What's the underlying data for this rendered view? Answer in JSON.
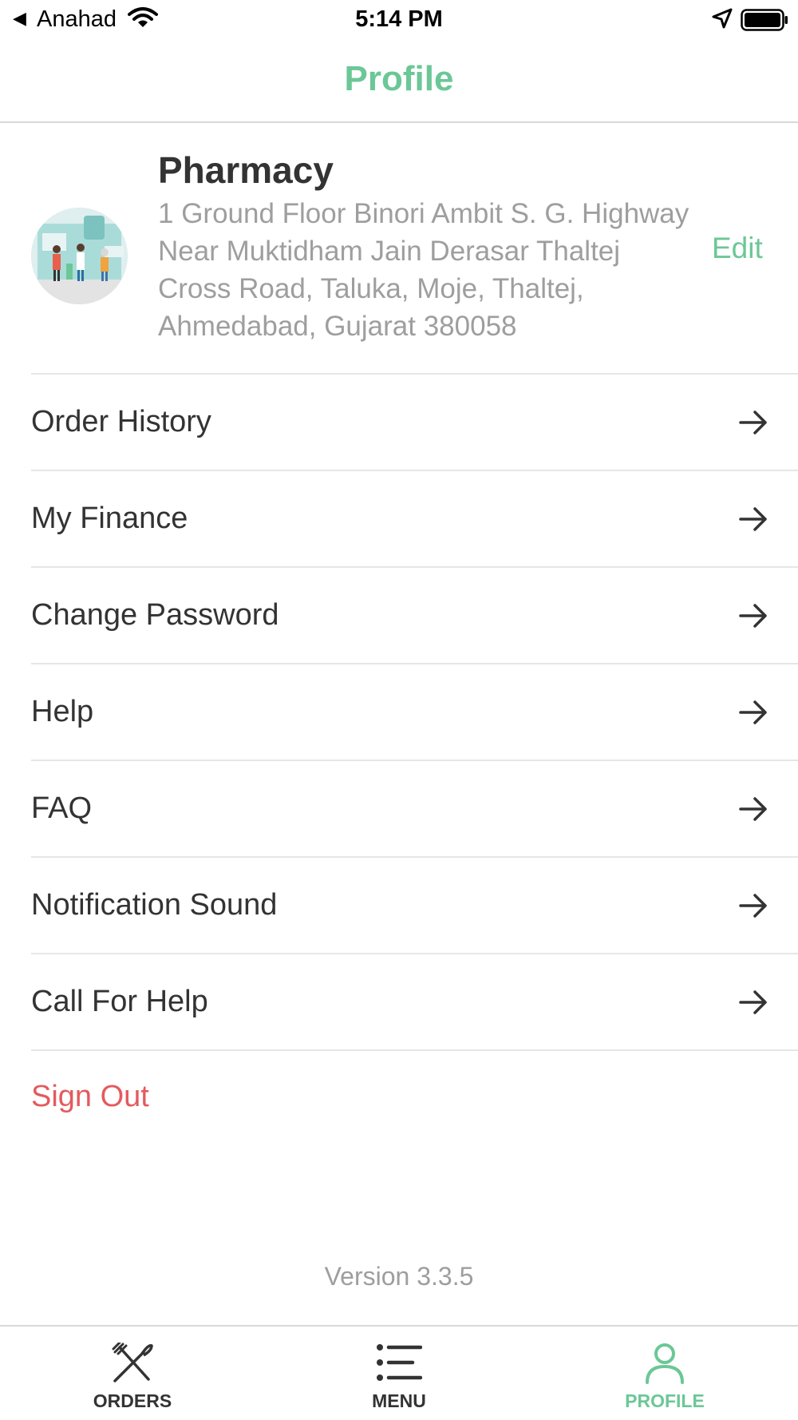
{
  "status_bar": {
    "back_label": "Anahad",
    "time": "5:14 PM"
  },
  "nav": {
    "title": "Profile"
  },
  "profile": {
    "name": "Pharmacy",
    "address": "1 Ground Floor Binori Ambit S. G. Highway Near Muktidham Jain Derasar Thaltej Cross Road, Taluka, Moje, Thaltej, Ahmedabad, Gujarat 380058",
    "edit_label": "Edit"
  },
  "menu": {
    "items": [
      {
        "label": "Order History",
        "icon": "arrow-right-icon"
      },
      {
        "label": "My Finance",
        "icon": "arrow-right-icon"
      },
      {
        "label": "Change Password",
        "icon": "arrow-right-icon"
      },
      {
        "label": "Help",
        "icon": "arrow-right-icon"
      },
      {
        "label": "FAQ",
        "icon": "arrow-right-icon"
      },
      {
        "label": "Notification Sound",
        "icon": "arrow-right-icon"
      },
      {
        "label": "Call For Help",
        "icon": "arrow-right-icon"
      }
    ],
    "sign_out": "Sign Out"
  },
  "version": "Version 3.3.5",
  "tabs": [
    {
      "label": "ORDERS",
      "icon": "fork-knife-icon",
      "active": false
    },
    {
      "label": "MENU",
      "icon": "list-icon",
      "active": false
    },
    {
      "label": "PROFILE",
      "icon": "person-icon",
      "active": true
    }
  ],
  "colors": {
    "accent": "#6cc797",
    "danger": "#e45a5e",
    "muted": "#9e9e9e",
    "text": "#333333"
  }
}
